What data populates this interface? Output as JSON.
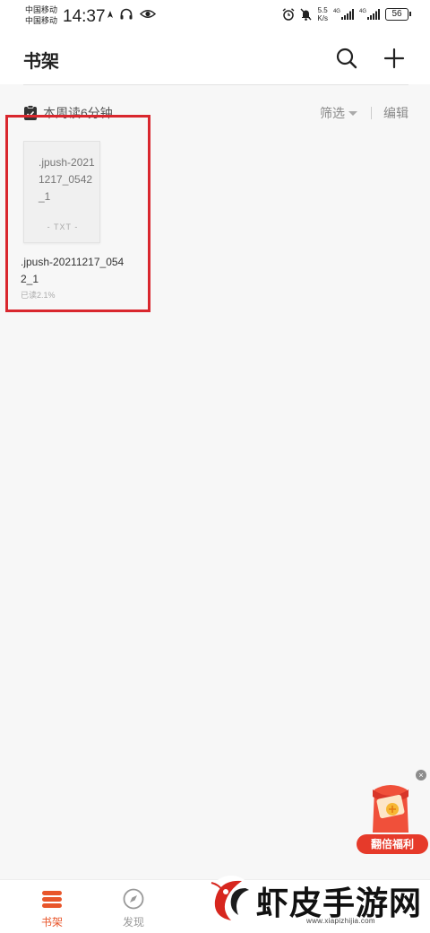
{
  "status_bar": {
    "carrier_1": "中国移动",
    "carrier_2": "中国移动",
    "time": "14:37",
    "net_speed_value": "5.5",
    "net_speed_unit": "K/s",
    "battery": "56",
    "network_1": "4G",
    "network_2": "4G"
  },
  "header": {
    "title": "书架"
  },
  "info_row": {
    "reading_time": "本周读6分钟",
    "filter_label": "筛选",
    "edit_label": "编辑"
  },
  "books": [
    {
      "cover_title": ".jpush-20211217_0542_1",
      "format": "- TXT -",
      "name": ".jpush-20211217_0542_1",
      "progress_text": "已读2.1%",
      "progress_percent": 2.1
    }
  ],
  "promo": {
    "label": "翻倍福利",
    "close": "×"
  },
  "nav": {
    "tabs": [
      {
        "label": "书架",
        "active": true
      },
      {
        "label": "发现",
        "active": false
      }
    ]
  },
  "watermark": {
    "text": "虾皮手游网",
    "url": "www.xiapizhijia.com"
  },
  "colors": {
    "accent": "#e8552a",
    "highlight_box": "#d9272e",
    "promo_red": "#e63a2a"
  }
}
